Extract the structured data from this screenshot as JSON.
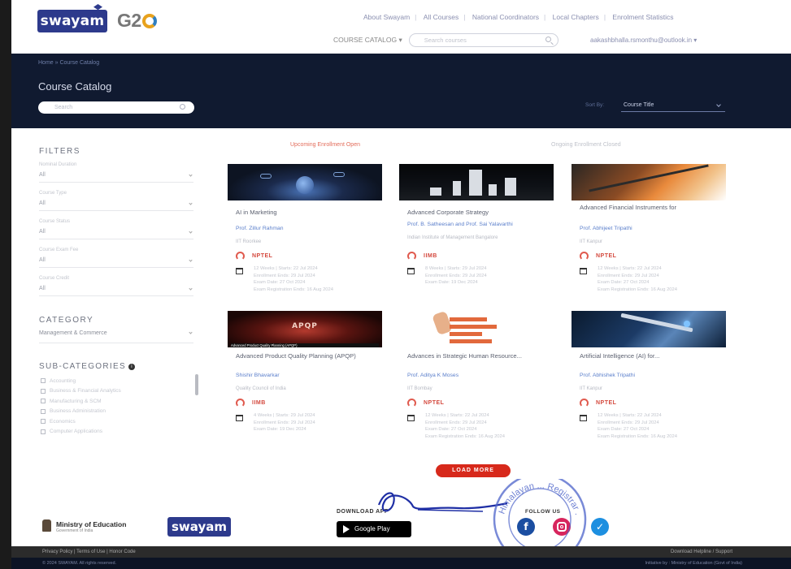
{
  "header": {
    "logo_text": "swayam",
    "partner_logo_text": "G2",
    "nav": [
      "About Swayam",
      "All Courses",
      "National Coordinators",
      "Local Chapters",
      "Enrolment Statistics"
    ],
    "catalog_label": "COURSE CATALOG ▾",
    "search_placeholder": "Search courses",
    "user_email": "aakashbhalla.rsmonthu@outlook.in ▾"
  },
  "hero": {
    "breadcrumb": "Home » Course Catalog",
    "title": "Course Catalog",
    "search_placeholder": "Search",
    "sort_label": "Sort By:",
    "sort_value": "Course Title"
  },
  "filters": {
    "title": "FILTERS",
    "items": [
      {
        "label": "Nominal Duration",
        "value": "All"
      },
      {
        "label": "Course Type",
        "value": "All"
      },
      {
        "label": "Course Status",
        "value": "All"
      },
      {
        "label": "Course Exam Fee",
        "value": "All"
      },
      {
        "label": "Course Credit",
        "value": "All"
      }
    ]
  },
  "category": {
    "title": "CATEGORY",
    "value": "Management & Commerce"
  },
  "subcategories": {
    "title": "SUB-CATEGORIES",
    "info_glyph": "i",
    "items": [
      "Accounting",
      "Business & Financial Analytics",
      "Manufacturing & SCM",
      "Business Administration",
      "Economics",
      "Computer Applications"
    ]
  },
  "tabs": {
    "active": "Upcoming Enrollment Open",
    "idle": "Ongoing Enrollment Closed"
  },
  "courses": [
    {
      "title": "AI in Marketing",
      "professor": "Prof. Zillur Rahman",
      "institute": "IIT Roorkee",
      "provider": "NPTEL",
      "dates": [
        "12 Weeks | Starts: 22 Jul 2024",
        "Enrollment Ends: 29 Jul 2024",
        "Exam Date: 27 Oct 2024",
        "Exam Registration Ends: 16 Aug 2024"
      ]
    },
    {
      "title": "Advanced Corporate Strategy",
      "professor": "Prof. B. Satheesan and Prof. Sai Yalavarthi",
      "institute": "Indian Institute of Management Bangalore",
      "provider": "IIMB",
      "dates": [
        "8 Weeks | Starts: 29 Jul 2024",
        "Enrollment Ends: 29 Jul 2024",
        "Exam Date: 19 Dec 2024"
      ]
    },
    {
      "title": "Advanced Financial Instruments for",
      "professor": "Prof. Abhijeet Tripathi",
      "institute": "IIT Kanpur",
      "provider": "NPTEL",
      "dates": [
        "12 Weeks | Starts: 22 Jul 2024",
        "Enrollment Ends: 29 Jul 2024",
        "Exam Date: 27 Oct 2024",
        "Exam Registration Ends: 16 Aug 2024"
      ]
    },
    {
      "title": "Advanced Product Quality Planning (APQP)",
      "professor": "Shishir Bhavarkar",
      "institute": "Quality Council of India",
      "provider": "IIMB",
      "dates": [
        "4 Weeks | Starts: 29 Jul 2024",
        "Enrollment Ends: 29 Jul 2024",
        "Exam Date: 19 Dec 2024"
      ],
      "thumb_word": "APQP",
      "thumb_caption": "Advanced Product Quality Planning (APQP)"
    },
    {
      "title": "Advances in Strategic Human Resource...",
      "professor": "Prof. Aditya K Moses",
      "institute": "IIT Bombay",
      "provider": "NPTEL",
      "dates": [
        "12 Weeks | Starts: 22 Jul 2024",
        "Enrollment Ends: 29 Jul 2024",
        "Exam Date: 27 Oct 2024",
        "Exam Registration Ends: 16 Aug 2024"
      ]
    },
    {
      "title": "Artificial Intelligence (AI) for...",
      "professor": "Prof. Abhishek Tripathi",
      "institute": "IIT Kanpur",
      "provider": "NPTEL",
      "dates": [
        "12 Weeks | Starts: 22 Jul 2024",
        "Enrollment Ends: 29 Jul 2024",
        "Exam Date: 27 Oct 2024",
        "Exam Registration Ends: 16 Aug 2024"
      ]
    }
  ],
  "load_more": "LOAD MORE",
  "footer": {
    "ministry": "Ministry of Education",
    "ministry_sub": "Government of India",
    "logo_text": "swayam",
    "download_label": "DOWNLOAD APP",
    "gplay": "Google Play",
    "follow_label": "FOLLOW US",
    "social": {
      "facebook": "f",
      "twitter": "✓"
    },
    "bar1_left": "Privacy Policy | Terms of Use | Honor Code",
    "bar1_right": "Download Helpline / Support",
    "bar2_left": "© 2024 SWAYAM. All rights reserved.",
    "bar2_right": "Initiative by : Ministry of Education (Govt of India)",
    "stamp_text": "Himalayan ... Registrar ..."
  },
  "colors": {
    "brand": "#2d3a8c",
    "hero": "#101a30",
    "accent": "#d7291b",
    "link": "#5b7fcb"
  }
}
